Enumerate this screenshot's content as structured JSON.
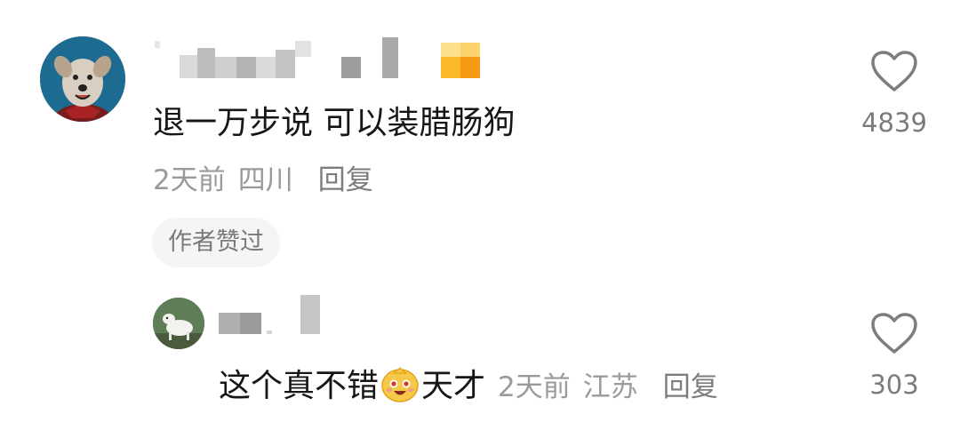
{
  "comment": {
    "text": "退一万步说 可以装腊肠狗",
    "time": "2天前",
    "location": "四川",
    "reply_label": "回复",
    "author_liked_badge": "作者赞过",
    "like_count": "4839",
    "avatar_icon": "dog-avatar",
    "name_icon": "pixelated-username"
  },
  "reply": {
    "text_before": "这个真不错",
    "emoji_icon": "grinning-face-emoji",
    "text_after": "天才",
    "time": "2天前",
    "location": "江苏",
    "reply_label": "回复",
    "like_count": "303",
    "avatar_icon": "dog-avatar",
    "name_icon": "pixelated-username"
  },
  "colors": {
    "primary_text": "#161616",
    "meta_text": "#9a9a9a",
    "badge_bg": "#f5f5f5",
    "level_badge": "#f5a623"
  }
}
